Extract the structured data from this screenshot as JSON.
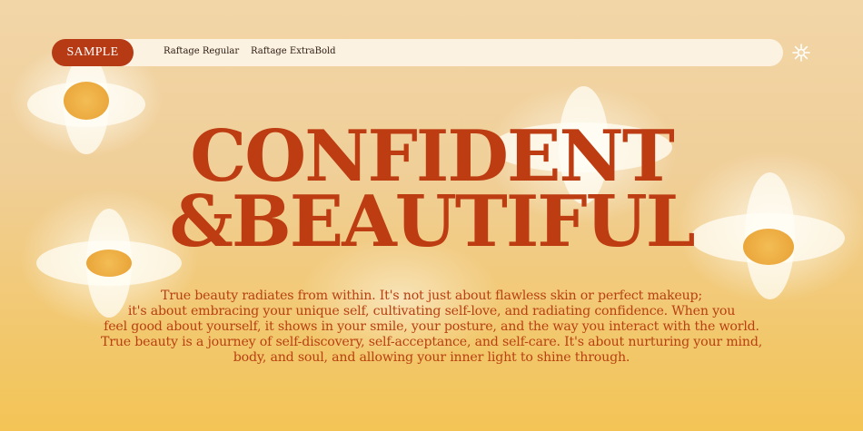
{
  "nav": {
    "sample_label": "SAMPLE",
    "links": [
      "Raftage Regular",
      "Raftage ExtraBold"
    ],
    "menu_icon": "flower-icon"
  },
  "headline": {
    "line1": "CONFIDENT",
    "line2": "&BEAUTIFUL"
  },
  "body_lines": [
    "True beauty radiates from within. It's not just about flawless skin or perfect makeup;",
    "it's about embracing your unique self, cultivating self-love, and radiating confidence. When you",
    "feel good about yourself, it shows in your smile, your posture, and the way you interact with the world.",
    "True beauty is a journey of self-discovery, self-acceptance, and self-care. It's about nurturing your mind,",
    "body, and soul, and allowing your inner light to shine through."
  ],
  "colors": {
    "accent": "#bd3c12",
    "pill": "#b63a14",
    "background": "#f2d6a8"
  }
}
